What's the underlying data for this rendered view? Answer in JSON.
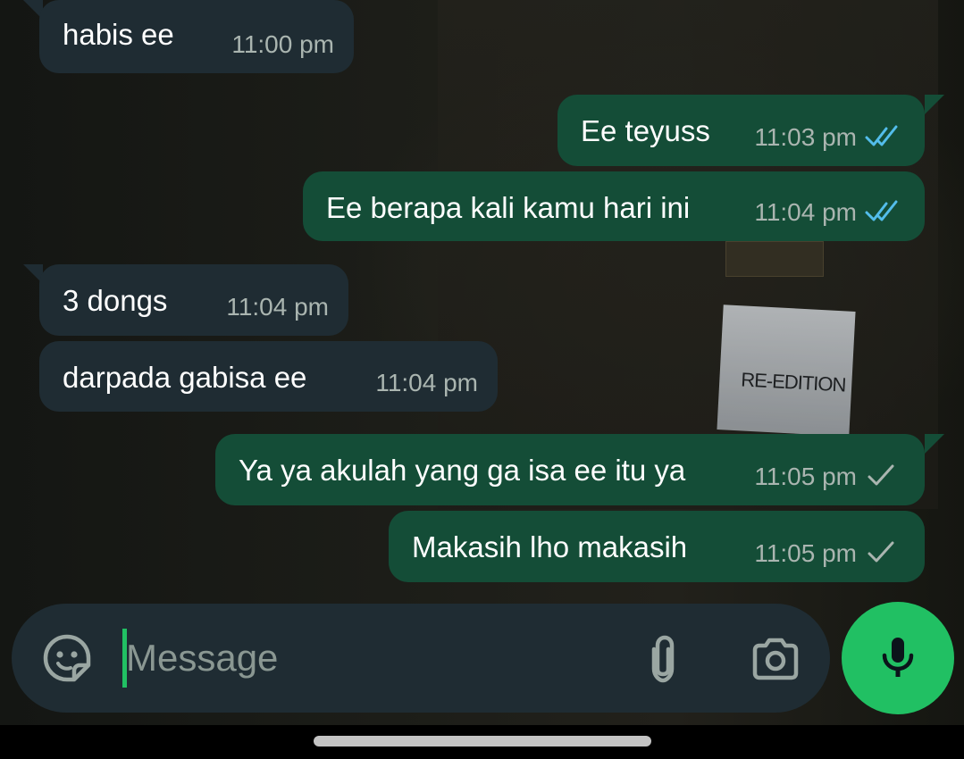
{
  "messages": [
    {
      "direction": "incoming",
      "text": "habis ee",
      "time": "11:00 pm",
      "status": ""
    },
    {
      "direction": "outgoing",
      "text": "Ee teyuss",
      "time": "11:03 pm",
      "status": "read"
    },
    {
      "direction": "outgoing",
      "text": "Ee berapa kali kamu hari ini",
      "time": "11:04 pm",
      "status": "read"
    },
    {
      "direction": "incoming",
      "text": "3 dongs",
      "time": "11:04 pm",
      "status": ""
    },
    {
      "direction": "incoming",
      "text": "darpada gabisa ee",
      "time": "11:04 pm",
      "status": ""
    },
    {
      "direction": "outgoing",
      "text": "Ya ya akulah yang ga isa ee itu ya",
      "time": "11:05 pm",
      "status": "sent"
    },
    {
      "direction": "outgoing",
      "text": "Makasih lho makasih",
      "time": "11:05 pm",
      "status": "sent"
    }
  ],
  "composer": {
    "placeholder": "Message",
    "icons": {
      "sticker": "sticker-icon",
      "attach": "paperclip-icon",
      "camera": "camera-icon",
      "mic": "microphone-icon"
    }
  },
  "wallpaper": {
    "tag_text": "RE-EDITION"
  },
  "colors": {
    "incoming_bubble": "#1f2c33",
    "outgoing_bubble": "#144d37",
    "accent": "#21c063",
    "read_tick": "#53bdeb",
    "sent_tick": "#aab5b0"
  }
}
